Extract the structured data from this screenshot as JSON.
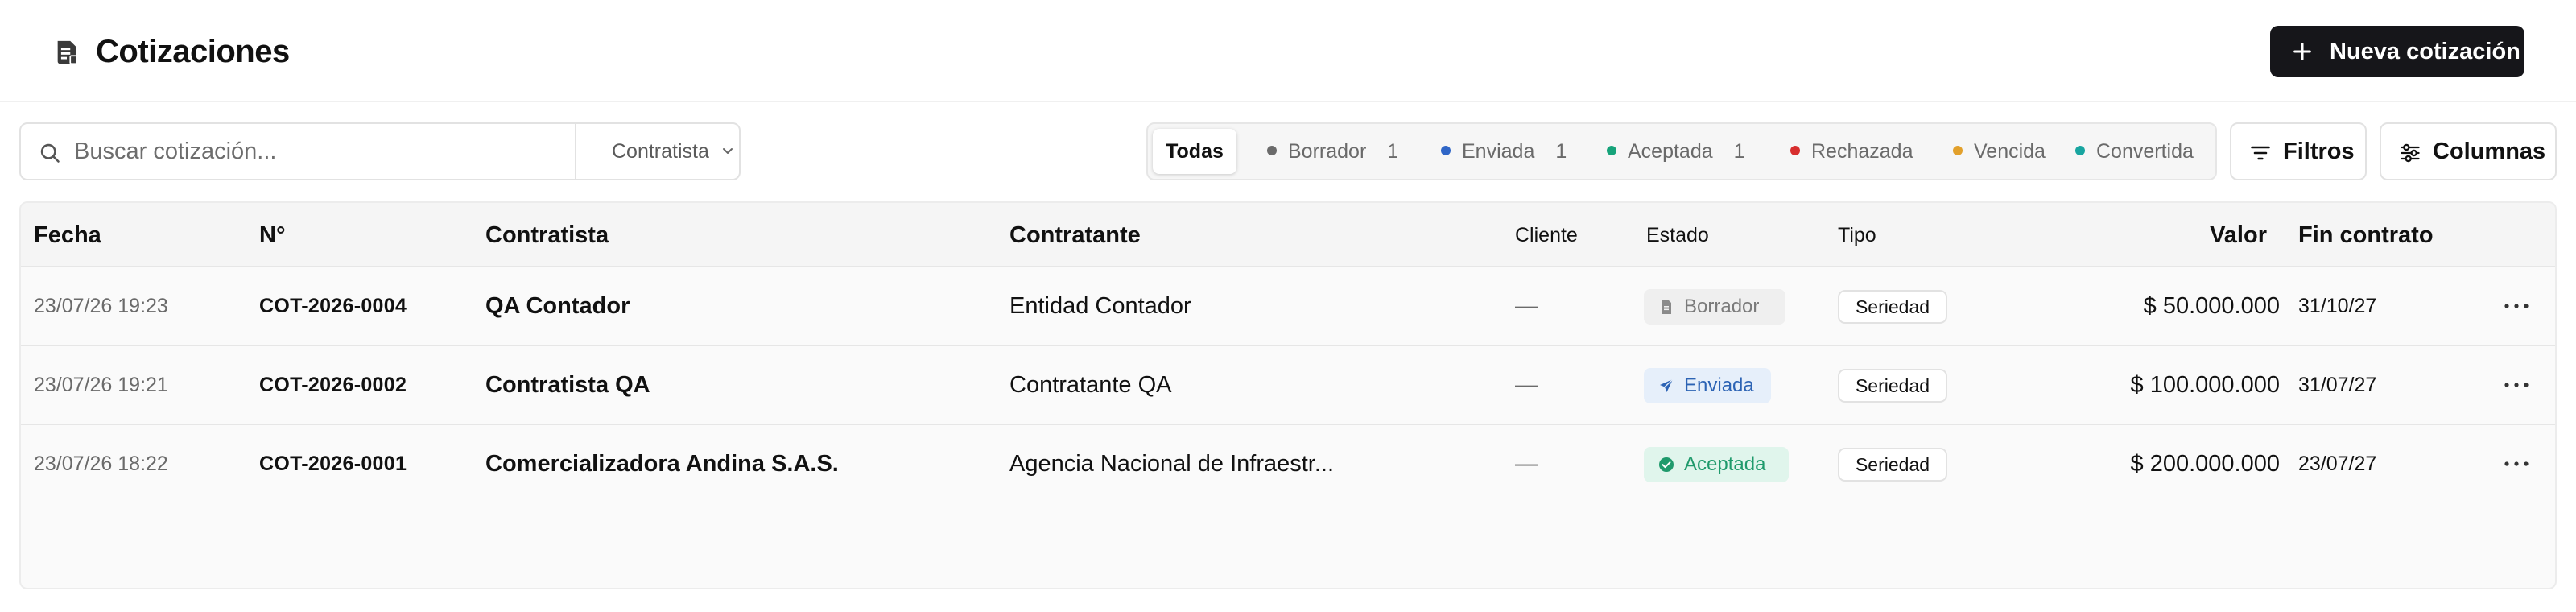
{
  "header": {
    "title": "Cotizaciones",
    "new_button_label": "Nueva cotización"
  },
  "toolbar": {
    "search_placeholder": "Buscar cotización...",
    "search_value": "",
    "role_select": "Contratista",
    "filters_label": "Filtros",
    "columns_label": "Columnas"
  },
  "status_tabs": [
    {
      "label": "Todas",
      "count": "",
      "color": "",
      "active": true
    },
    {
      "label": "Borrador",
      "count": "1",
      "color": "#6b6b6b"
    },
    {
      "label": "Enviada",
      "count": "1",
      "color": "#2f66c7"
    },
    {
      "label": "Aceptada",
      "count": "1",
      "color": "#16a37a"
    },
    {
      "label": "Rechazada",
      "count": "",
      "color": "#d72e2e"
    },
    {
      "label": "Vencida",
      "count": "",
      "color": "#e2a02b"
    },
    {
      "label": "Convertida",
      "count": "",
      "color": "#18a5a0"
    }
  ],
  "table": {
    "columns": {
      "fecha": "Fecha",
      "numero": "N°",
      "contratista": "Contratista",
      "contratante": "Contratante",
      "cliente": "Cliente",
      "estado": "Estado",
      "tipo": "Tipo",
      "valor": "Valor",
      "fin_contrato": "Fin contrato"
    },
    "rows": [
      {
        "fecha": "23/07/26 19:23",
        "numero": "COT-2026-0004",
        "contratista": "QA Contador",
        "contratante": "Entidad Contador",
        "cliente": "—",
        "estado": "Borrador",
        "tipo": "Seriedad",
        "valor": "$ 50.000.000",
        "fin_contrato": "31/10/27"
      },
      {
        "fecha": "23/07/26 19:21",
        "numero": "COT-2026-0002",
        "contratista": "Contratista QA",
        "contratante": "Contratante QA",
        "cliente": "—",
        "estado": "Enviada",
        "tipo": "Seriedad",
        "valor": "$ 100.000.000",
        "fin_contrato": "31/07/27"
      },
      {
        "fecha": "23/07/26 18:22",
        "numero": "COT-2026-0001",
        "contratista": "Comercializadora Andina S.A.S.",
        "contratante": "Agencia Nacional de Infraestr...",
        "cliente": "—",
        "estado": "Aceptada",
        "tipo": "Seriedad",
        "valor": "$ 200.000.000",
        "fin_contrato": "23/07/27"
      }
    ]
  },
  "icons": {
    "title": "document-icon",
    "new": "plus-icon",
    "search": "search-icon",
    "select": "chevron-down-icon",
    "filters": "filter-icon",
    "columns": "sliders-icon",
    "row_menu": "more-horizontal-icon",
    "borrador": "file-icon",
    "enviada": "send-icon",
    "aceptada": "check-circle-icon"
  }
}
